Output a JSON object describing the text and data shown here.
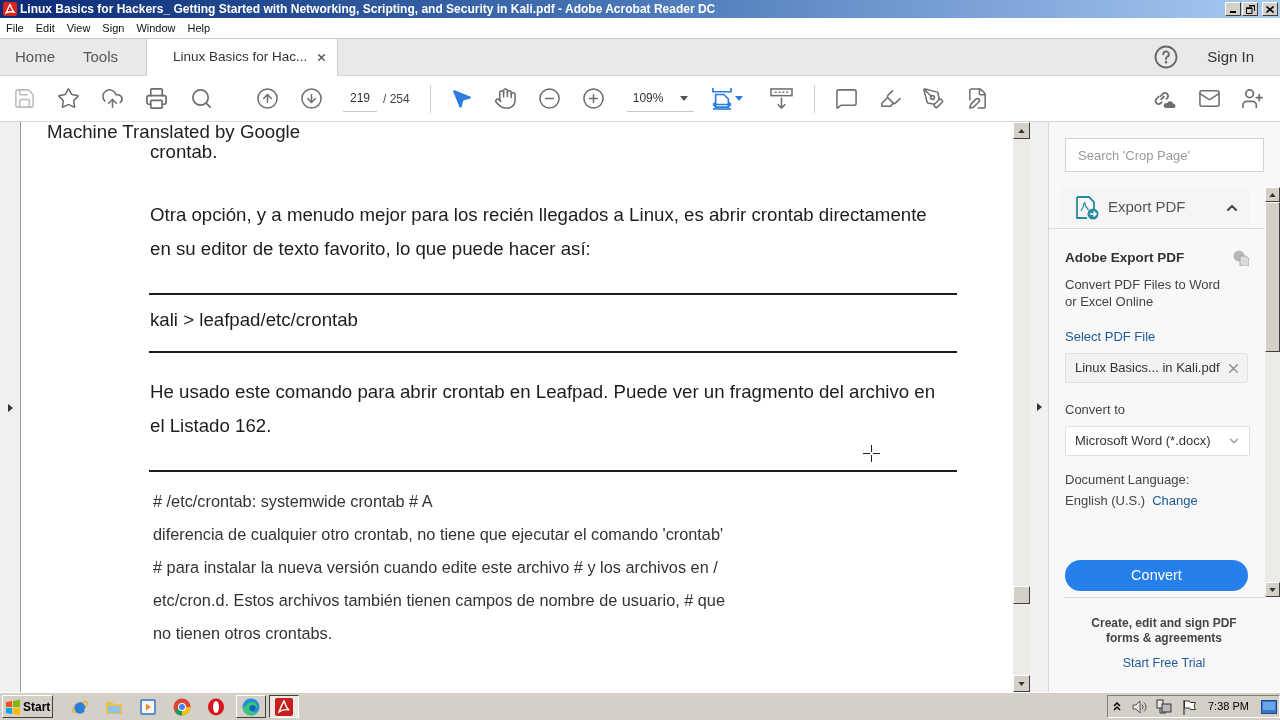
{
  "window": {
    "title": "Linux Basics for Hackers_ Getting Started with Networking, Scripting, and Security in Kali.pdf - Adobe Acrobat Reader DC"
  },
  "menu_bar": [
    "File",
    "Edit",
    "View",
    "Sign",
    "Window",
    "Help"
  ],
  "tabs": [
    {
      "label": "Home",
      "selected": false,
      "closable": false
    },
    {
      "label": "Tools",
      "selected": false,
      "closable": false
    },
    {
      "label": "Linux Basics for Hac...",
      "selected": true,
      "closable": true
    }
  ],
  "account": {
    "sign_in": "Sign In"
  },
  "toolbar": {
    "save_disabled": true,
    "page_current": "219",
    "page_total": "/ 254",
    "pointer_selected": true,
    "hand_selected": false,
    "zoom": "109%"
  },
  "document": {
    "header": "Machine Translated by Google",
    "blocks": [
      {
        "kind": "text",
        "text": "crontab."
      },
      {
        "kind": "paragraph",
        "text": "Otra opción, y a menudo mejor para los recién llegados a Linux, es abrir crontab directamente en su editor de texto favorito, lo que puede hacer así:"
      },
      {
        "kind": "rule"
      },
      {
        "kind": "command",
        "text": "kali > leafpad/etc/crontab"
      },
      {
        "kind": "rule"
      },
      {
        "kind": "paragraph",
        "text": "He usado este comando para abrir crontab en Leafpad. Puede ver un fragmento del archivo en el Listado 162."
      },
      {
        "kind": "rule"
      },
      {
        "kind": "listing",
        "lines": [
          "# /etc/crontab: systemwide crontab # A",
          "diferencia de cualquier otro crontab, no tiene que ejecutar el comando 'crontab'",
          "# para instalar la nueva versión cuando edite este archivo # y los archivos en /",
          "etc/cron.d. Estos archivos también tienen campos de nombre de usuario, # que",
          "no tienen otros crontabs."
        ]
      }
    ]
  },
  "tools_pane": {
    "search": {
      "placeholder": "Search 'Crop Page'"
    },
    "section": {
      "title": "Export PDF",
      "expanded": true
    },
    "heading": "Adobe Export PDF",
    "description": "Convert PDF Files to Word or Excel Online",
    "select_file": "Select PDF File",
    "file": {
      "value": "Linux Basics... in Kali.pdf"
    },
    "convert_to_label": "Convert to",
    "format": {
      "value": "Microsoft Word (*.docx)"
    },
    "language_label": "Document Language:",
    "language": "English (U.S.)",
    "change": "Change",
    "convert_button": "Convert",
    "promo": {
      "text": "Create, edit and sign PDF forms & agreements",
      "link": "Start Free Trial"
    }
  },
  "taskbar": {
    "start": "Start",
    "apps": [
      {
        "kind": "ie",
        "running": false,
        "selected": false
      },
      {
        "kind": "folder",
        "running": false,
        "selected": false
      },
      {
        "kind": "media",
        "running": false,
        "selected": false
      },
      {
        "kind": "chrome",
        "running": false,
        "selected": false
      },
      {
        "kind": "opera",
        "running": false,
        "selected": false
      },
      {
        "kind": "edge",
        "running": true,
        "selected": false
      },
      {
        "kind": "acrobat",
        "running": true,
        "selected": true
      }
    ],
    "clock": "7:38 PM"
  }
}
